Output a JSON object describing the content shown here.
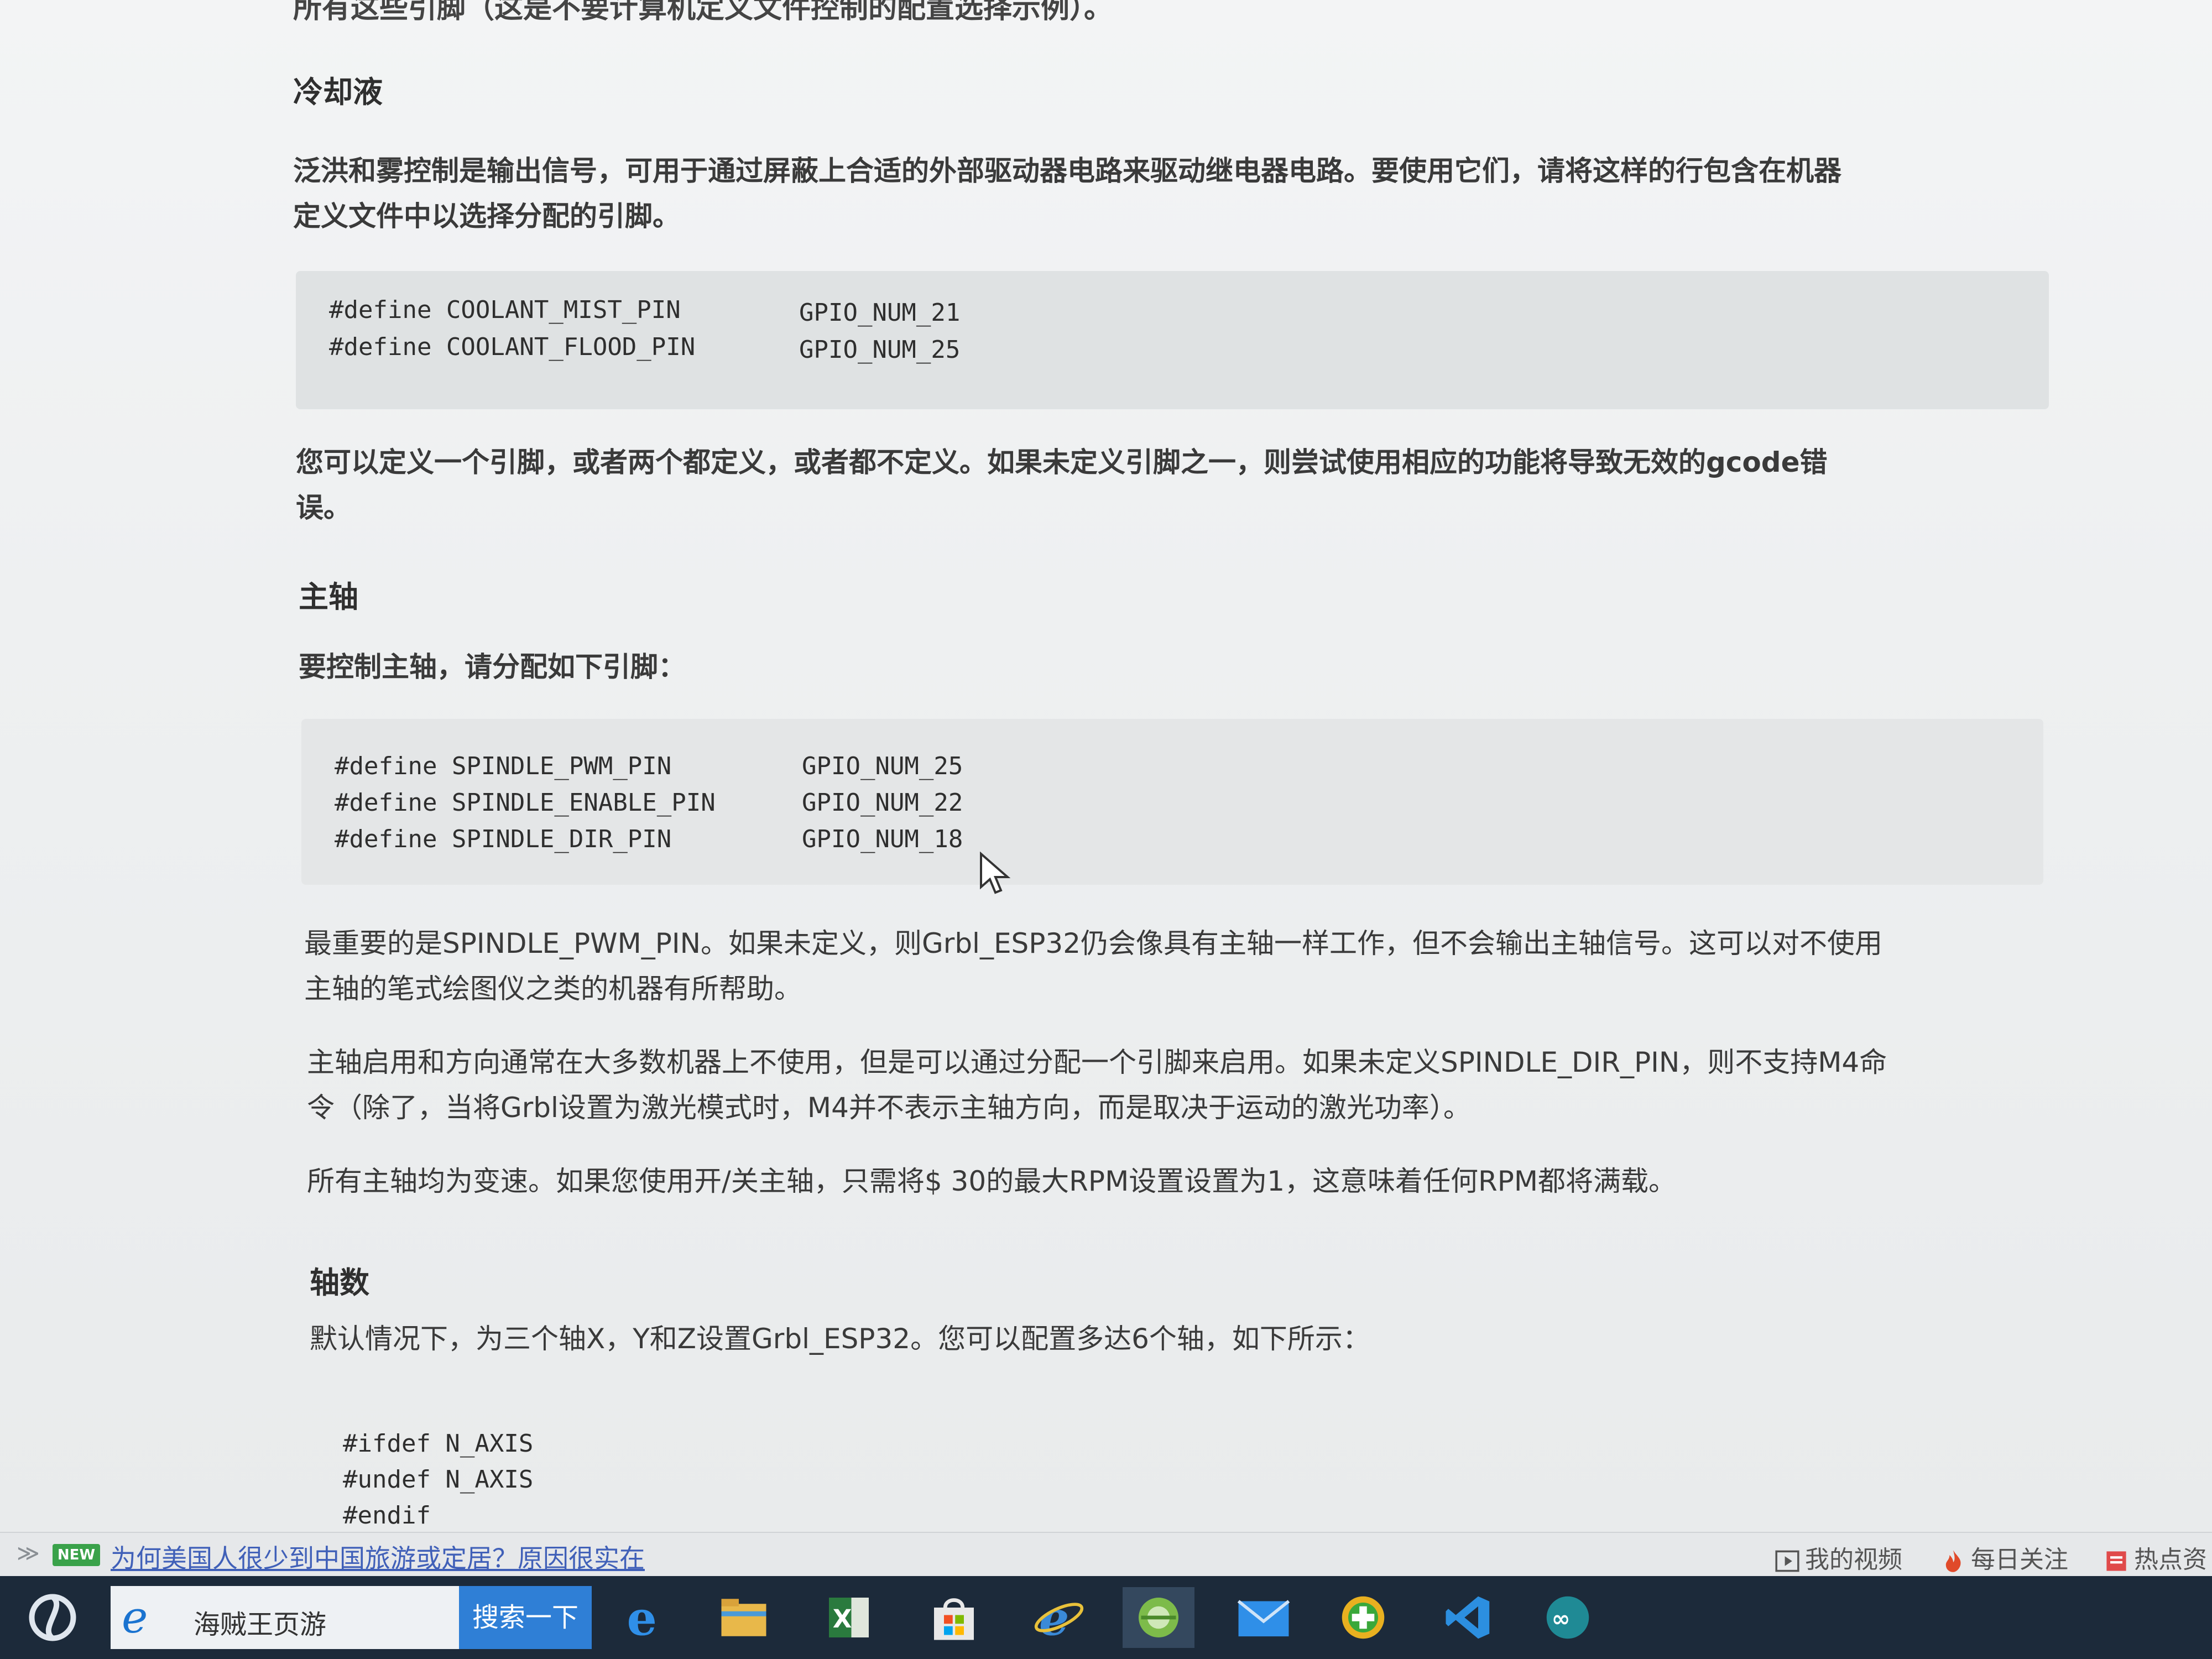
{
  "doc": {
    "top_cut": "所有这些引脚（这是不要计算机定义文件控制的配置选择示例）。",
    "coolant_heading": "冷却液",
    "coolant_para": "泛洪和雾控制是输出信号，可用于通过屏蔽上合适的外部驱动器电路来驱动继电器电路。要使用它们，请将这样的行包含在机器\n定义文件中以选择分配的引脚。",
    "coolant_code": [
      {
        "left": "#define COOLANT_MIST_PIN",
        "right": "GPIO_NUM_21"
      },
      {
        "left": "#define COOLANT_FLOOD_PIN",
        "right": "GPIO_NUM_25"
      }
    ],
    "coolant_note": "您可以定义一个引脚，或者两个都定义，或者都不定义。如果未定义引脚之一，则尝试使用相应的功能将导致无效的gcode错\n误。",
    "spindle_heading": "主轴",
    "spindle_intro": "要控制主轴，请分配如下引脚：",
    "spindle_code": [
      {
        "left": "#define SPINDLE_PWM_PIN",
        "right": "GPIO_NUM_25"
      },
      {
        "left": "#define SPINDLE_ENABLE_PIN",
        "right": "GPIO_NUM_22"
      },
      {
        "left": "#define SPINDLE_DIR_PIN",
        "right": "GPIO_NUM_18"
      }
    ],
    "spindle_p1": "最重要的是SPINDLE_PWM_PIN。如果未定义，则Grbl_ESP32仍会像具有主轴一样工作，但不会输出主轴信号。这可以对不使用\n主轴的笔式绘图仪之类的机器有所帮助。",
    "spindle_p2": "主轴启用和方向通常在大多数机器上不使用，但是可以通过分配一个引脚来启用。如果未定义SPINDLE_DIR_PIN，则不支持M4命\n令（除了，当将Grbl设置为激光模式时，M4并不表示主轴方向，而是取决于运动的激光功率）。",
    "spindle_p3": "所有主轴均为变速。如果您使用开/关主轴，只需将$ 30的最大RPM设置设置为1，这意味着任何RPM都将满载。",
    "axes_heading": "轴数",
    "axes_intro": "默认情况下，为三个轴X，Y和Z设置Grbl_ESP32。您可以配置多达6个轴，如下所示：",
    "axes_code": [
      "#ifdef N_AXIS",
      "#undef N_AXIS",
      "#endif"
    ]
  },
  "newsbar": {
    "badge": "NEW",
    "headline": "为何美国人很少到中国旅游或定居？原因很实在",
    "my_video": "我的视频",
    "daily_follow": "每日关注",
    "hot_news": "热点资"
  },
  "taskbar": {
    "search_text": "海贼王页游",
    "search_button": "搜索一下"
  },
  "colors": {
    "taskbar_bg": "#1c2a3a",
    "search_button": "#2f7fd6",
    "code_bg": "#dfe2e3",
    "link": "#4060b8"
  }
}
